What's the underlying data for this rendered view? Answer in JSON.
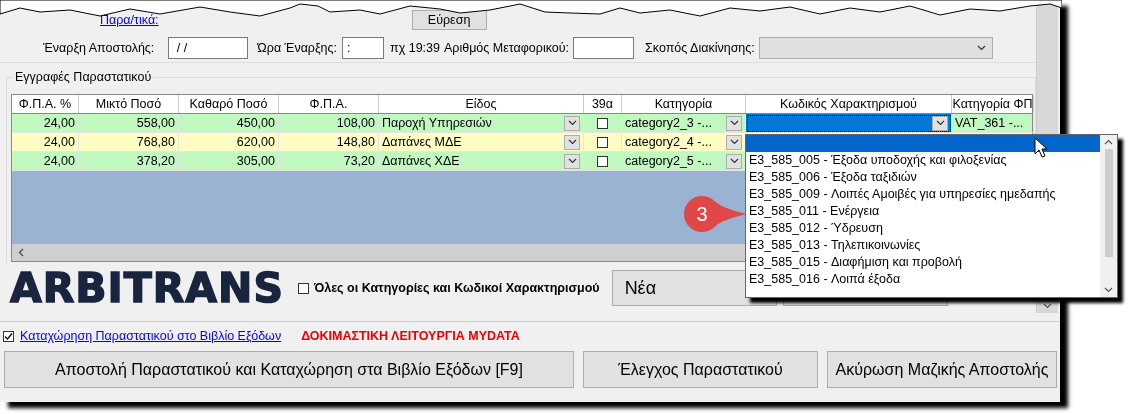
{
  "top_link": "Παρα/τικά:",
  "find_button": "Εύρεση",
  "shipment": {
    "start_label": "Έναρξη Αποστολής:",
    "start_value": " / /",
    "time_label": "Ώρα Έναρξης:",
    "time_value": ":",
    "time_hint": "πχ 19:39",
    "vehicle_label": "Αριθμός Μεταφορικού:",
    "purpose_label": "Σκοπός Διακίνησης:",
    "purpose_disabled": true
  },
  "entries": {
    "title": "Εγγραφές Παραστατικού",
    "columns": [
      "Φ.Π.Α. %",
      "Μικτό Ποσό",
      "Καθαρό Ποσό",
      "Φ.Π.Α.",
      "Είδος",
      "39α",
      "Κατηγορία",
      "Κωδικός Χαρακτηρισμού",
      "Κατηγορία ΦΠ"
    ],
    "rows": [
      {
        "vat_rate": "24,00",
        "gross": "558,00",
        "net": "450,00",
        "vat": "108,00",
        "type": "Παροχή Υπηρεσιών",
        "art_39a": false,
        "category": "category2_3  -...",
        "focused": true,
        "vat_category": "VAT_361  -...",
        "color": "#c0f8c0"
      },
      {
        "vat_rate": "24,00",
        "gross": "768,80",
        "net": "620,00",
        "vat": "148,80",
        "type": "Δαπάνες ΜΔΕ",
        "art_39a": false,
        "category": "category2_4  -...",
        "color": "#fffdc4"
      },
      {
        "vat_rate": "24,00",
        "gross": "378,20",
        "net": "305,00",
        "vat": "73,20",
        "type": "Δαπάνες ΧΔΕ",
        "art_39a": false,
        "category": "category2_5  -...",
        "color": "#c0f8c0"
      }
    ]
  },
  "code_dropdown": {
    "items": [
      {
        "selected": true
      },
      {
        "label": "E3_585_005 - Έξοδα υποδοχής και φιλοξενίας",
        "selected": false
      },
      {
        "label": "E3_585_006 - Έξοδα ταξιδιών",
        "selected": false
      },
      {
        "label": "E3_585_009 - Λοιπές Αμοιβές για υπηρεσίες ημεδαπής",
        "selected": false
      },
      {
        "label": "E3_585_011 - Ενέργεια",
        "selected": false
      },
      {
        "label": "E3_585_012 - Ύδρευση",
        "selected": false
      },
      {
        "label": "E3_585_013 - Τηλεπικοινωνίες",
        "selected": false
      },
      {
        "label": "E3_585_015 - Διαφήμιση και προβολή",
        "selected": false
      },
      {
        "label": "E3_585_016 - Λοιπά έξοδα",
        "selected": false
      }
    ]
  },
  "callout": "3",
  "brand": "ARBITRANS",
  "all_categories": {
    "label": "Όλες οι Κατηγορίες και Κωδικοί Χαρακτηρισμού",
    "checked": false
  },
  "new_button": "Νέα",
  "register": {
    "label": "Καταχώρηση Παραστατικού στο Βιβλίο Εξόδων",
    "checked": true
  },
  "test_mode": "ΔΟΚΙΜΑΣΤΙΚΗ ΛΕΙΤΟΥΡΓΙΑ MYDATA",
  "actions": [
    "Αποστολή Παραστατικού και Καταχώρηση στα Βιβλίο Εξόδων [F9]",
    "Έλεγχος Παραστατικού",
    "Ακύρωση Μαζικής Αποστολής"
  ]
}
